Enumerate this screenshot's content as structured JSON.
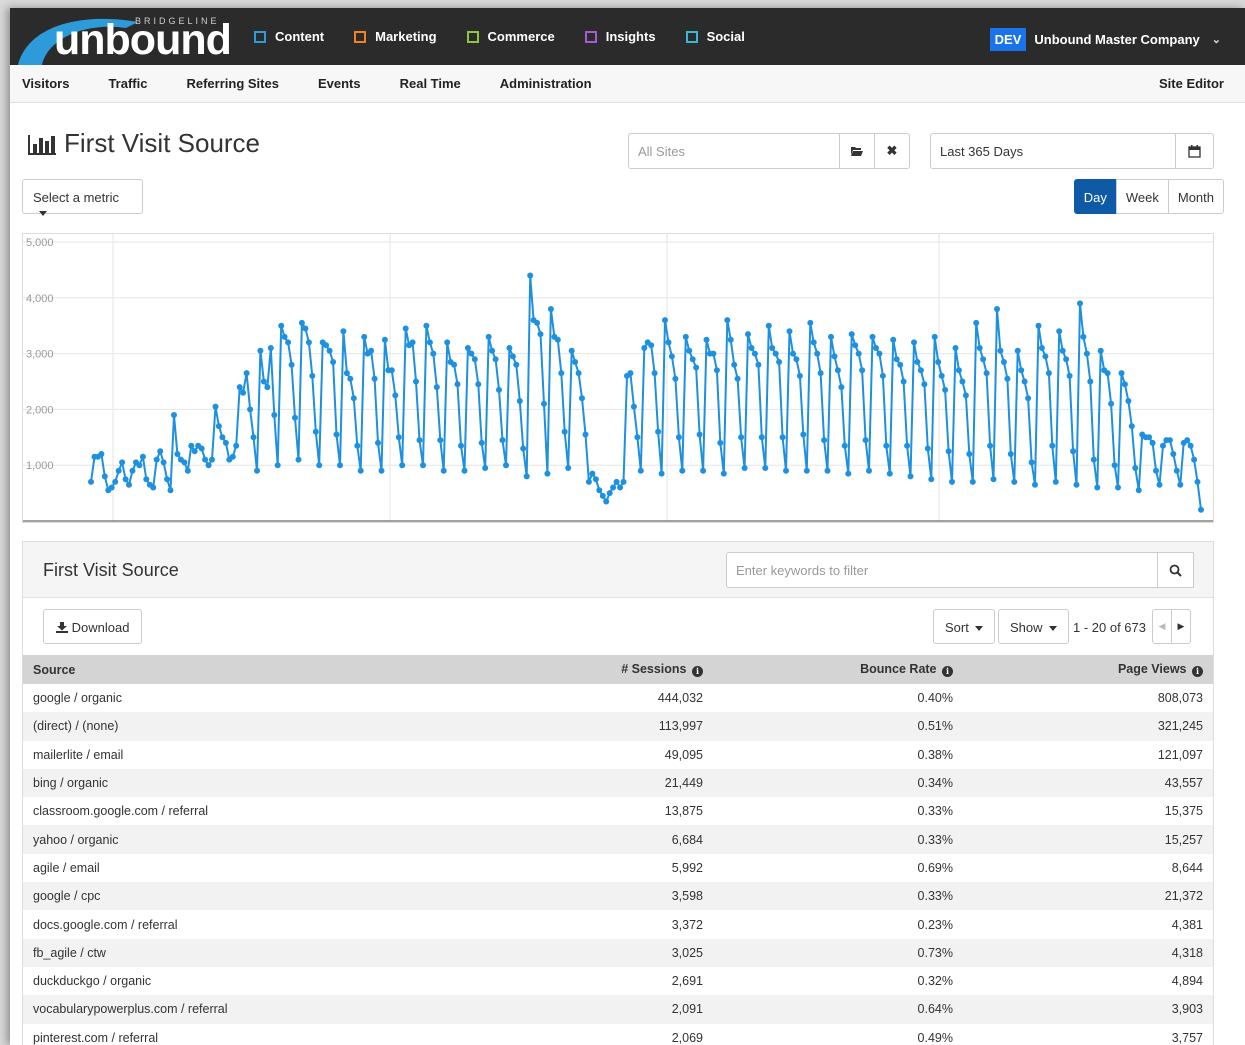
{
  "app": {
    "brand_top": "BRIDGELINE",
    "brand": "unbound",
    "modules": [
      {
        "label": "Content",
        "color": "#2d9bd9"
      },
      {
        "label": "Marketing",
        "color": "#f58220"
      },
      {
        "label": "Commerce",
        "color": "#8cc63f"
      },
      {
        "label": "Insights",
        "color": "#a35bd6"
      },
      {
        "label": "Social",
        "color": "#3ab7d8"
      }
    ],
    "env_badge": "DEV",
    "company": "Unbound Master Company"
  },
  "subnav": {
    "items": [
      "Visitors",
      "Traffic",
      "Referring Sites",
      "Events",
      "Real Time",
      "Administration"
    ],
    "right": "Site Editor"
  },
  "page": {
    "title": "First Visit Source",
    "sites_placeholder": "All Sites",
    "date_range": "Last 365 Days",
    "metric_select": "Select a metric",
    "granularity": [
      "Day",
      "Week",
      "Month"
    ],
    "granularity_active": "Day"
  },
  "chart_data": {
    "type": "line",
    "ylim": [
      0,
      5000
    ],
    "yticks": [
      "1,000",
      "2,000",
      "3,000",
      "4,000",
      "5,000"
    ],
    "color": "#1e90e0",
    "values": [
      700,
      1150,
      1150,
      1200,
      800,
      550,
      600,
      700,
      900,
      1050,
      750,
      650,
      900,
      1050,
      1000,
      1150,
      750,
      650,
      600,
      1100,
      1250,
      1050,
      750,
      550,
      1900,
      1200,
      1100,
      1050,
      900,
      1350,
      1250,
      1350,
      1300,
      1100,
      1000,
      1100,
      2050,
      1700,
      1500,
      1400,
      1100,
      1150,
      1350,
      2400,
      2300,
      2650,
      2000,
      1500,
      900,
      3050,
      2500,
      2400,
      3100,
      1900,
      1000,
      3500,
      3300,
      3200,
      2800,
      1850,
      1100,
      3550,
      3450,
      3200,
      2600,
      1600,
      1000,
      3200,
      3150,
      3050,
      2850,
      1550,
      1000,
      3400,
      2650,
      2550,
      2200,
      1350,
      900,
      3300,
      3000,
      3050,
      2550,
      1400,
      900,
      3250,
      2700,
      2700,
      2250,
      1500,
      1000,
      3450,
      3150,
      3200,
      2500,
      1450,
      1000,
      3500,
      3200,
      3000,
      2400,
      1450,
      900,
      3200,
      2850,
      2800,
      2450,
      1350,
      900,
      3100,
      3000,
      2900,
      2450,
      1400,
      950,
      3300,
      3050,
      2900,
      2350,
      1450,
      1000,
      3100,
      2950,
      2800,
      2150,
      1300,
      800,
      4400,
      3600,
      3550,
      3350,
      2100,
      850,
      3800,
      3300,
      3250,
      2650,
      1600,
      950,
      3050,
      2850,
      2650,
      2200,
      1550,
      700,
      850,
      750,
      550,
      450,
      350,
      500,
      600,
      700,
      600,
      700,
      2600,
      2650,
      2050,
      1500,
      900,
      3100,
      3200,
      3150,
      2650,
      1600,
      850,
      3600,
      3200,
      2950,
      2550,
      1500,
      900,
      3300,
      3050,
      2900,
      2750,
      1550,
      900,
      3250,
      3000,
      3000,
      2700,
      1400,
      850,
      3600,
      3250,
      2800,
      2550,
      1500,
      950,
      3350,
      3100,
      3000,
      2800,
      1500,
      950,
      3500,
      3100,
      3000,
      2850,
      1500,
      900,
      3400,
      3000,
      2900,
      2600,
      1550,
      900,
      3550,
      3200,
      3000,
      2650,
      1450,
      900,
      3300,
      2950,
      2700,
      2400,
      1350,
      850,
      3350,
      3150,
      3000,
      2700,
      1450,
      900,
      3300,
      3100,
      3000,
      2600,
      1350,
      850,
      3250,
      2900,
      2800,
      2500,
      1350,
      800,
      3200,
      2850,
      2700,
      2450,
      1300,
      750,
      3300,
      2850,
      2600,
      2350,
      1250,
      700,
      3100,
      2700,
      2500,
      2250,
      1200,
      700,
      3550,
      3100,
      2900,
      2650,
      1350,
      750,
      3800,
      3050,
      2850,
      2550,
      1200,
      700,
      3050,
      2700,
      2500,
      2200,
      1050,
      650,
      3500,
      3100,
      2950,
      2650,
      1350,
      700,
      3400,
      3050,
      2900,
      2600,
      1250,
      650,
      3900,
      3300,
      3000,
      2500,
      1100,
      600,
      3050,
      2700,
      2650,
      2100,
      1000,
      600,
      2650,
      2450,
      2150,
      1700,
      950,
      550,
      1550,
      1500,
      1500,
      1400,
      900,
      650,
      1350,
      1450,
      1450,
      1200,
      900,
      650,
      1400,
      1450,
      1350,
      1100,
      700,
      200
    ]
  },
  "table": {
    "title": "First Visit Source",
    "filter_placeholder": "Enter keywords to filter",
    "download": "Download",
    "sort": "Sort",
    "show": "Show",
    "pager": "1 - 20 of 673",
    "columns": [
      "Source",
      "# Sessions",
      "Bounce Rate",
      "Page Views"
    ],
    "rows": [
      [
        "google / organic",
        "444,032",
        "0.40%",
        "808,073"
      ],
      [
        "(direct) / (none)",
        "113,997",
        "0.51%",
        "321,245"
      ],
      [
        "mailerlite / email",
        "49,095",
        "0.38%",
        "121,097"
      ],
      [
        "bing / organic",
        "21,449",
        "0.34%",
        "43,557"
      ],
      [
        "classroom.google.com / referral",
        "13,875",
        "0.33%",
        "15,375"
      ],
      [
        "yahoo / organic",
        "6,684",
        "0.33%",
        "15,257"
      ],
      [
        "agile / email",
        "5,992",
        "0.69%",
        "8,644"
      ],
      [
        "google / cpc",
        "3,598",
        "0.33%",
        "21,372"
      ],
      [
        "docs.google.com / referral",
        "3,372",
        "0.23%",
        "4,381"
      ],
      [
        "fb_agile / ctw",
        "3,025",
        "0.73%",
        "4,318"
      ],
      [
        "duckduckgo / organic",
        "2,691",
        "0.32%",
        "4,894"
      ],
      [
        "vocabularypowerplus.com / referral",
        "2,091",
        "0.64%",
        "3,903"
      ],
      [
        "pinterest.com / referral",
        "2,069",
        "0.49%",
        "3,757"
      ]
    ]
  }
}
